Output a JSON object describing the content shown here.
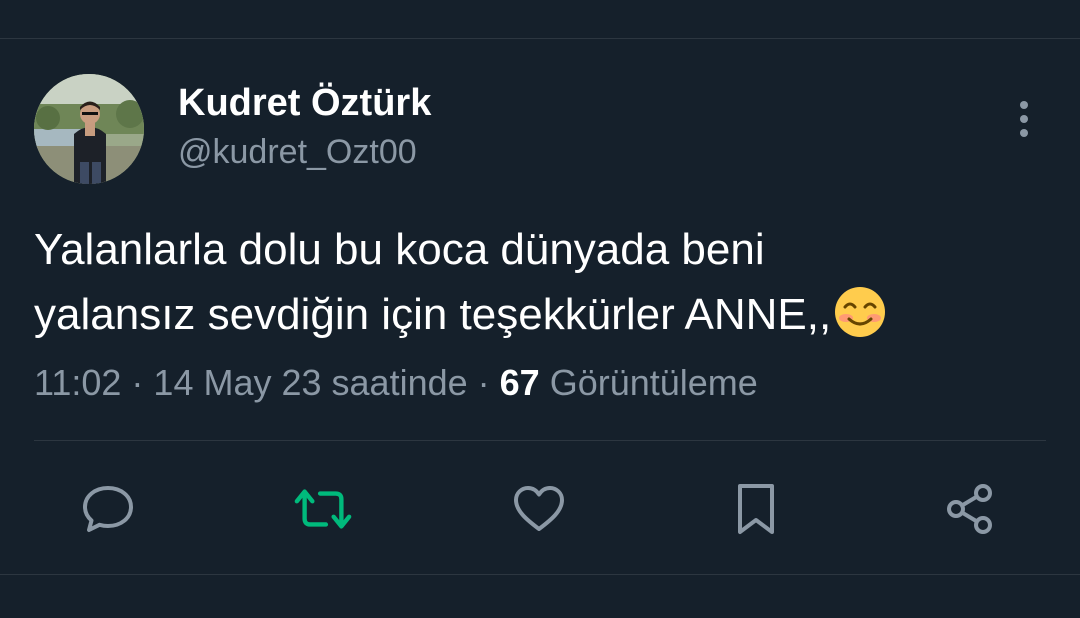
{
  "tweet": {
    "author": {
      "display_name": "Kudret Öztürk",
      "handle": "@kudret_Ozt00"
    },
    "text_line1": "Yalanlarla dolu bu koca dünyada beni",
    "text_line2": "yalansız sevdiğin için teşekkürler ANNE,,",
    "emoji": "smiling-face-with-smiling-eyes",
    "meta": {
      "time": "11:02",
      "date": "14 May 23 saatinde",
      "separator": "·",
      "views_count": "67",
      "views_label": "Görüntüleme"
    },
    "actions": [
      "reply-icon",
      "retweet-icon",
      "like-icon",
      "bookmark-icon",
      "share-icon"
    ]
  },
  "colors": {
    "background": "#15202b",
    "text": "#ffffff",
    "secondary_text": "#8b98a5",
    "divider": "#2c3640",
    "retweet_active": "#00ba7c"
  }
}
